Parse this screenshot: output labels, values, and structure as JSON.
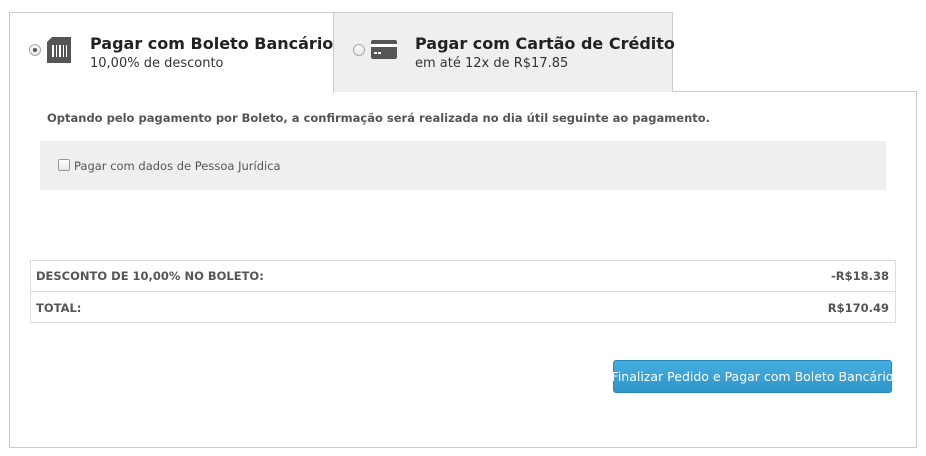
{
  "tabs": [
    {
      "title": "Pagar com Boleto Bancário",
      "subtitle": "10,00% de desconto",
      "icon": "barcode-icon",
      "selected": true
    },
    {
      "title": "Pagar com Cartão de Crédito",
      "subtitle": "em até 12x de R$17.85",
      "icon": "credit-card-icon",
      "selected": false
    }
  ],
  "boleto": {
    "info": "Optando pelo pagamento por Boleto, a confirmação será realizada no dia útil seguinte ao pagamento.",
    "pj_checkbox_label": "Pagar com dados de Pessoa Jurídica",
    "pj_checked": false
  },
  "summary": {
    "rows": [
      {
        "label": "DESCONTO DE 10,00% NO BOLETO:",
        "value": "-R$18.38"
      },
      {
        "label": "TOTAL:",
        "value": "R$170.49"
      }
    ]
  },
  "actions": {
    "finish_label": "Finalizar Pedido e Pagar com Boleto Bancário"
  },
  "colors": {
    "accent": "#3aa3d6",
    "inactive_tab_bg": "#efefef",
    "border": "#cccccc"
  }
}
